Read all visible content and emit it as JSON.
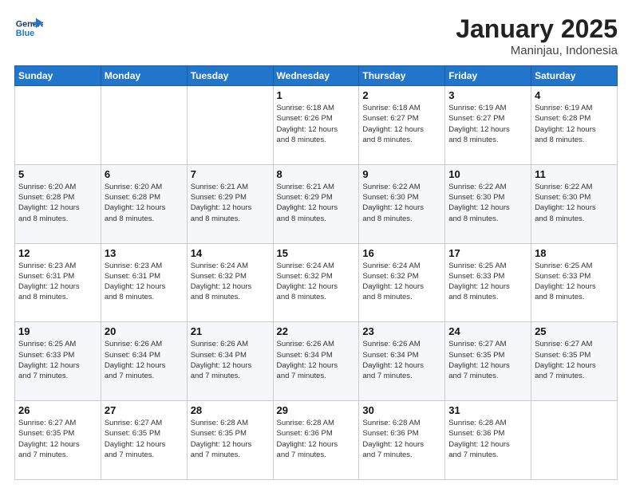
{
  "header": {
    "logo_line1": "General",
    "logo_line2": "Blue",
    "month": "January 2025",
    "location": "Maninjau, Indonesia"
  },
  "weekdays": [
    "Sunday",
    "Monday",
    "Tuesday",
    "Wednesday",
    "Thursday",
    "Friday",
    "Saturday"
  ],
  "weeks": [
    [
      {
        "day": "",
        "info": ""
      },
      {
        "day": "",
        "info": ""
      },
      {
        "day": "",
        "info": ""
      },
      {
        "day": "1",
        "info": "Sunrise: 6:18 AM\nSunset: 6:26 PM\nDaylight: 12 hours\nand 8 minutes."
      },
      {
        "day": "2",
        "info": "Sunrise: 6:18 AM\nSunset: 6:27 PM\nDaylight: 12 hours\nand 8 minutes."
      },
      {
        "day": "3",
        "info": "Sunrise: 6:19 AM\nSunset: 6:27 PM\nDaylight: 12 hours\nand 8 minutes."
      },
      {
        "day": "4",
        "info": "Sunrise: 6:19 AM\nSunset: 6:28 PM\nDaylight: 12 hours\nand 8 minutes."
      }
    ],
    [
      {
        "day": "5",
        "info": "Sunrise: 6:20 AM\nSunset: 6:28 PM\nDaylight: 12 hours\nand 8 minutes."
      },
      {
        "day": "6",
        "info": "Sunrise: 6:20 AM\nSunset: 6:28 PM\nDaylight: 12 hours\nand 8 minutes."
      },
      {
        "day": "7",
        "info": "Sunrise: 6:21 AM\nSunset: 6:29 PM\nDaylight: 12 hours\nand 8 minutes."
      },
      {
        "day": "8",
        "info": "Sunrise: 6:21 AM\nSunset: 6:29 PM\nDaylight: 12 hours\nand 8 minutes."
      },
      {
        "day": "9",
        "info": "Sunrise: 6:22 AM\nSunset: 6:30 PM\nDaylight: 12 hours\nand 8 minutes."
      },
      {
        "day": "10",
        "info": "Sunrise: 6:22 AM\nSunset: 6:30 PM\nDaylight: 12 hours\nand 8 minutes."
      },
      {
        "day": "11",
        "info": "Sunrise: 6:22 AM\nSunset: 6:30 PM\nDaylight: 12 hours\nand 8 minutes."
      }
    ],
    [
      {
        "day": "12",
        "info": "Sunrise: 6:23 AM\nSunset: 6:31 PM\nDaylight: 12 hours\nand 8 minutes."
      },
      {
        "day": "13",
        "info": "Sunrise: 6:23 AM\nSunset: 6:31 PM\nDaylight: 12 hours\nand 8 minutes."
      },
      {
        "day": "14",
        "info": "Sunrise: 6:24 AM\nSunset: 6:32 PM\nDaylight: 12 hours\nand 8 minutes."
      },
      {
        "day": "15",
        "info": "Sunrise: 6:24 AM\nSunset: 6:32 PM\nDaylight: 12 hours\nand 8 minutes."
      },
      {
        "day": "16",
        "info": "Sunrise: 6:24 AM\nSunset: 6:32 PM\nDaylight: 12 hours\nand 8 minutes."
      },
      {
        "day": "17",
        "info": "Sunrise: 6:25 AM\nSunset: 6:33 PM\nDaylight: 12 hours\nand 8 minutes."
      },
      {
        "day": "18",
        "info": "Sunrise: 6:25 AM\nSunset: 6:33 PM\nDaylight: 12 hours\nand 8 minutes."
      }
    ],
    [
      {
        "day": "19",
        "info": "Sunrise: 6:25 AM\nSunset: 6:33 PM\nDaylight: 12 hours\nand 7 minutes."
      },
      {
        "day": "20",
        "info": "Sunrise: 6:26 AM\nSunset: 6:34 PM\nDaylight: 12 hours\nand 7 minutes."
      },
      {
        "day": "21",
        "info": "Sunrise: 6:26 AM\nSunset: 6:34 PM\nDaylight: 12 hours\nand 7 minutes."
      },
      {
        "day": "22",
        "info": "Sunrise: 6:26 AM\nSunset: 6:34 PM\nDaylight: 12 hours\nand 7 minutes."
      },
      {
        "day": "23",
        "info": "Sunrise: 6:26 AM\nSunset: 6:34 PM\nDaylight: 12 hours\nand 7 minutes."
      },
      {
        "day": "24",
        "info": "Sunrise: 6:27 AM\nSunset: 6:35 PM\nDaylight: 12 hours\nand 7 minutes."
      },
      {
        "day": "25",
        "info": "Sunrise: 6:27 AM\nSunset: 6:35 PM\nDaylight: 12 hours\nand 7 minutes."
      }
    ],
    [
      {
        "day": "26",
        "info": "Sunrise: 6:27 AM\nSunset: 6:35 PM\nDaylight: 12 hours\nand 7 minutes."
      },
      {
        "day": "27",
        "info": "Sunrise: 6:27 AM\nSunset: 6:35 PM\nDaylight: 12 hours\nand 7 minutes."
      },
      {
        "day": "28",
        "info": "Sunrise: 6:28 AM\nSunset: 6:35 PM\nDaylight: 12 hours\nand 7 minutes."
      },
      {
        "day": "29",
        "info": "Sunrise: 6:28 AM\nSunset: 6:36 PM\nDaylight: 12 hours\nand 7 minutes."
      },
      {
        "day": "30",
        "info": "Sunrise: 6:28 AM\nSunset: 6:36 PM\nDaylight: 12 hours\nand 7 minutes."
      },
      {
        "day": "31",
        "info": "Sunrise: 6:28 AM\nSunset: 6:36 PM\nDaylight: 12 hours\nand 7 minutes."
      },
      {
        "day": "",
        "info": ""
      }
    ]
  ]
}
